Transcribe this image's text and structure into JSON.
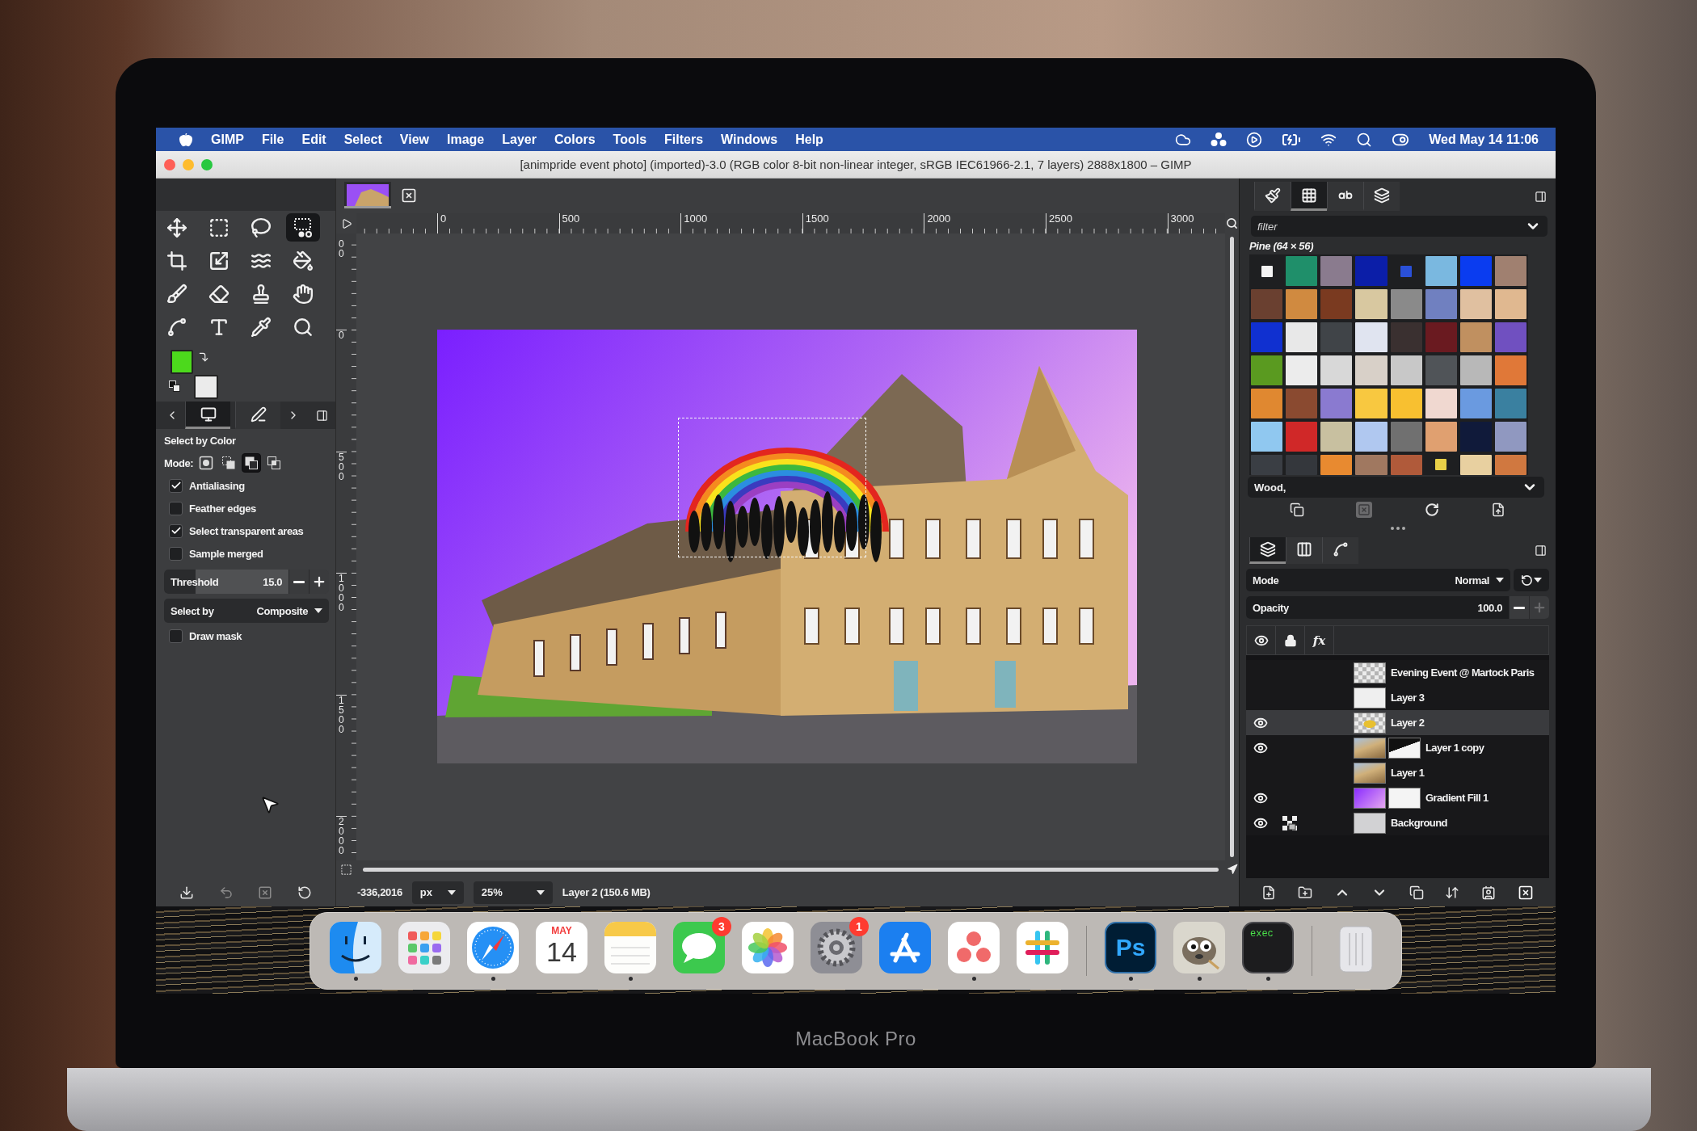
{
  "device_label": "MacBook Pro",
  "menu_bar": {
    "app": "GIMP",
    "menus": [
      "File",
      "Edit",
      "Select",
      "View",
      "Image",
      "Layer",
      "Colors",
      "Tools",
      "Filters",
      "Windows",
      "Help"
    ],
    "clock": "Wed May 14 11:06"
  },
  "window": {
    "controls": [
      {
        "color": "#fe5f57"
      },
      {
        "color": "#febc2e"
      },
      {
        "color": "#28c840"
      }
    ],
    "title": "[animpride event photo] (imported)-3.0 (RGB color 8-bit non-linear integer, sRGB IEC61966-2.1, 7 layers) 2888x1800 – GIMP"
  },
  "toolbox": {
    "tools": [
      {
        "kind": "move",
        "selected": false
      },
      {
        "kind": "rect-select",
        "selected": false
      },
      {
        "kind": "lasso",
        "selected": false
      },
      {
        "kind": "color-select",
        "selected": true
      },
      {
        "kind": "crop",
        "selected": false
      },
      {
        "kind": "transform",
        "selected": false
      },
      {
        "kind": "warp",
        "selected": false
      },
      {
        "kind": "fill",
        "selected": false
      },
      {
        "kind": "paintbrush",
        "selected": false
      },
      {
        "kind": "eraser",
        "selected": false
      },
      {
        "kind": "clone",
        "selected": false
      },
      {
        "kind": "smudge",
        "selected": false
      },
      {
        "kind": "paths",
        "selected": false
      },
      {
        "kind": "text",
        "selected": false
      },
      {
        "kind": "color-picker",
        "selected": false
      },
      {
        "kind": "zoom",
        "selected": false
      }
    ],
    "colors": [
      {
        "kind": "foreground",
        "color": "#4cd91c"
      },
      {
        "kind": "background",
        "color": "#ebebeb"
      }
    ],
    "tabs": [
      {
        "kind": "tool-options",
        "selected": true
      },
      {
        "kind": "device-status",
        "selected": false
      }
    ]
  },
  "tool_options": {
    "title": "Select by Color",
    "mode_label": "Mode:",
    "modes": [
      {
        "kind": "replace",
        "selected": false
      },
      {
        "kind": "add",
        "selected": false
      },
      {
        "kind": "subtract",
        "selected": true
      },
      {
        "kind": "intersect",
        "selected": false
      }
    ],
    "options": [
      {
        "label": "Antialiasing",
        "checked": true
      },
      {
        "label": "Feather edges",
        "checked": false
      },
      {
        "label": "Select transparent areas",
        "checked": true
      },
      {
        "label": "Sample merged",
        "checked": false
      }
    ],
    "threshold": {
      "label": "Threshold",
      "value": "15.0",
      "level": 0.25
    },
    "select_by": {
      "label": "Select by",
      "value": "Composite"
    },
    "draw_mask": {
      "label": "Draw mask",
      "checked": false
    }
  },
  "canvas": {
    "image_tabs": [
      {
        "selected": true
      }
    ],
    "h_ruler": [
      "0",
      "500",
      "1000",
      "1500",
      "2000",
      "2500",
      "3000"
    ],
    "v_ruler": [
      "00",
      "0",
      "500",
      "1000",
      "1500",
      "2000"
    ]
  },
  "status_bar": {
    "pointer": "-336,2016",
    "unit": "px",
    "zoom": "25%",
    "layer_info": "Layer 2 (150.6 MB)"
  },
  "patterns": {
    "tabs": [
      {
        "kind": "brushes",
        "selected": false
      },
      {
        "kind": "patterns",
        "selected": true
      },
      {
        "kind": "fonts",
        "selected": false
      },
      {
        "kind": "stack",
        "selected": false
      }
    ],
    "filter_placeholder": "filter",
    "current": "Pine (64 × 56)",
    "items": [
      {
        "color": "#f4f4f4",
        "small": true
      },
      {
        "color": "#1f8f6a",
        "small": false
      },
      {
        "color": "#8a7b8e",
        "small": false
      },
      {
        "color": "#0b1ea8",
        "small": false
      },
      {
        "color": "#2a50d8",
        "small": true
      },
      {
        "color": "#7ab8e0",
        "small": false
      },
      {
        "color": "#0a3cf0",
        "small": false
      },
      {
        "color": "#a08070",
        "small": false
      },
      {
        "color": "#6a4030",
        "small": false
      },
      {
        "color": "#d08a40",
        "small": false
      },
      {
        "color": "#7a3a20",
        "small": false
      },
      {
        "color": "#d8c8a0",
        "small": false
      },
      {
        "color": "#8a8a8a",
        "small": false
      },
      {
        "color": "#7080c0",
        "small": false
      },
      {
        "color": "#e0c0a0",
        "small": false
      },
      {
        "color": "#e0b890",
        "small": false
      },
      {
        "color": "#1030d0",
        "small": false
      },
      {
        "color": "#e8e8e8",
        "small": false
      },
      {
        "color": "#404448",
        "small": false
      },
      {
        "color": "#e0e4f0",
        "small": false
      },
      {
        "color": "#3a3030",
        "small": false
      },
      {
        "color": "#6a1a20",
        "small": false
      },
      {
        "color": "#c09060",
        "small": false
      },
      {
        "color": "#7050c0",
        "small": false
      },
      {
        "color": "#5a9a20",
        "small": false
      },
      {
        "color": "#ececec",
        "small": false
      },
      {
        "color": "#d8d8d8",
        "small": false
      },
      {
        "color": "#d8d0c8",
        "small": false
      },
      {
        "color": "#c8c8c8",
        "small": false
      },
      {
        "color": "#505458",
        "small": false
      },
      {
        "color": "#b8b8b8",
        "small": false
      },
      {
        "color": "#e07838",
        "small": false
      },
      {
        "color": "#e08830",
        "small": false
      },
      {
        "color": "#8a4a30",
        "small": false
      },
      {
        "color": "#8a7ad0",
        "small": false
      },
      {
        "color": "#f8c840",
        "small": false
      },
      {
        "color": "#f8c030",
        "small": false
      },
      {
        "color": "#f0d8d0",
        "small": false
      },
      {
        "color": "#6a9ae0",
        "small": false
      },
      {
        "color": "#3a80a0",
        "small": false
      },
      {
        "color": "#90c8f0",
        "small": false
      },
      {
        "color": "#d02828",
        "small": false
      },
      {
        "color": "#c8c0a0",
        "small": false
      },
      {
        "color": "#b0c8f0",
        "small": false
      },
      {
        "color": "#707070",
        "small": false
      },
      {
        "color": "#e0a070",
        "small": false
      },
      {
        "color": "#101a3a",
        "small": false
      },
      {
        "color": "#9098c0",
        "small": false
      },
      {
        "color": "#3a3e44",
        "small": false
      },
      {
        "color": "#34373c",
        "small": false
      },
      {
        "color": "#e88a30",
        "small": false
      },
      {
        "color": "#a07860",
        "small": false
      },
      {
        "color": "#b05a3a",
        "small": false
      },
      {
        "color": "#e8d048",
        "small": true
      },
      {
        "color": "#e8d0a0",
        "small": false
      },
      {
        "color": "#d07840",
        "small": false
      }
    ],
    "tag": "Wood,",
    "delete_disabled": true
  },
  "layers": {
    "tabs": [
      {
        "kind": "layers",
        "selected": true
      },
      {
        "kind": "channels",
        "selected": false
      },
      {
        "kind": "paths",
        "selected": false
      }
    ],
    "mode": {
      "label": "Mode",
      "value": "Normal"
    },
    "opacity": {
      "label": "Opacity",
      "value": "100.0",
      "level": 1,
      "increase_disabled": true
    },
    "effects_label": "fx",
    "items": [
      {
        "name": "Evening Event @ Martock Paris",
        "visible": false,
        "alpha_locked": false,
        "selected": false,
        "thumb": {
          "kind": "checker"
        }
      },
      {
        "name": "Layer 3",
        "visible": false,
        "alpha_locked": false,
        "selected": false,
        "thumb": {
          "kind": "white"
        }
      },
      {
        "name": "Layer 2",
        "visible": true,
        "alpha_locked": false,
        "selected": true,
        "thumb": {
          "kind": "checker-art"
        }
      },
      {
        "name": "Layer 1 copy",
        "visible": true,
        "alpha_locked": false,
        "selected": false,
        "thumb": {
          "kind": "photo"
        },
        "mask": {
          "kind": "shape"
        }
      },
      {
        "name": "Layer 1",
        "visible": false,
        "alpha_locked": false,
        "selected": false,
        "thumb": {
          "kind": "photo"
        }
      },
      {
        "name": "Gradient Fill 1",
        "visible": true,
        "alpha_locked": false,
        "selected": false,
        "thumb": {
          "kind": "gradient"
        },
        "mask": {
          "kind": "white"
        }
      },
      {
        "name": "Background",
        "visible": true,
        "alpha_locked": true,
        "selected": false,
        "thumb": {
          "kind": "grey"
        }
      }
    ]
  },
  "dock": {
    "sections": [
      {
        "apps": [
          {
            "kind": "face",
            "running": true
          },
          {
            "kind": "launcher",
            "running": false
          },
          {
            "kind": "compass",
            "running": true
          },
          {
            "kind": "calendar",
            "running": false,
            "month": "MAY",
            "day": "14"
          },
          {
            "kind": "notes",
            "running": true
          },
          {
            "kind": "chat",
            "running": false,
            "badge": "3"
          },
          {
            "kind": "flower",
            "running": false
          },
          {
            "kind": "gear",
            "running": false,
            "badge": "1"
          },
          {
            "kind": "store",
            "running": false
          },
          {
            "kind": "dots",
            "running": true
          },
          {
            "kind": "hash",
            "running": false
          }
        ]
      },
      {
        "apps": [
          {
            "kind": "label-tile",
            "running": true,
            "label": "Ps"
          },
          {
            "kind": "mascot",
            "running": true
          },
          {
            "kind": "terminal",
            "running": true,
            "label": "exec"
          }
        ]
      },
      {
        "apps": [
          {
            "kind": "trash",
            "running": false
          }
        ]
      }
    ]
  }
}
